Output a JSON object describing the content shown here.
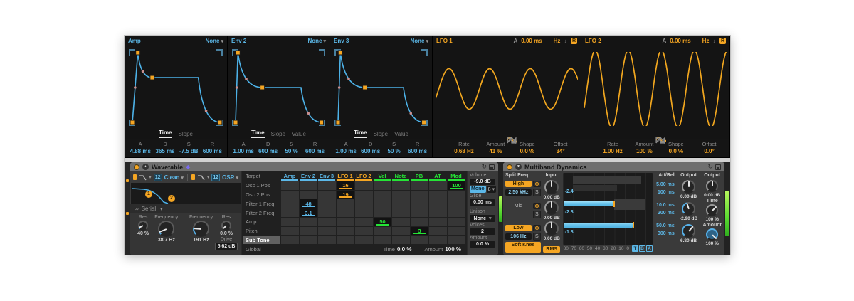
{
  "icons": {
    "caret": "▾",
    "sync_note": "♪",
    "link": "∞",
    "hotswap_device": "↻"
  },
  "env_panels": [
    {
      "name": "Amp",
      "mod_src": "None",
      "tabs": [
        "Time",
        "Slope"
      ],
      "active_tab": "Time",
      "adsr_labels": [
        "A",
        "D",
        "S",
        "R"
      ],
      "adsr_values": [
        "4.88 ms",
        "365 ms",
        "-7.5 dB",
        "600 ms"
      ],
      "curve": {
        "px": 0.13,
        "sx": 0.27,
        "sl": 0.38,
        "ex": 0.72,
        "rx": 0.93
      }
    },
    {
      "name": "Env 2",
      "mod_src": "None",
      "tabs": [
        "Time",
        "Slope",
        "Value"
      ],
      "active_tab": "Time",
      "adsr_labels": [
        "A",
        "D",
        "S",
        "R"
      ],
      "adsr_values": [
        "1.00 ms",
        "600 ms",
        "50 %",
        "600 ms"
      ],
      "curve": {
        "px": 0.1,
        "sx": 0.34,
        "sl": 0.5,
        "ex": 0.72,
        "rx": 0.92
      }
    },
    {
      "name": "Env 3",
      "mod_src": "None",
      "tabs": [
        "Time",
        "Slope",
        "Value"
      ],
      "active_tab": "Time",
      "adsr_labels": [
        "A",
        "D",
        "S",
        "R"
      ],
      "adsr_values": [
        "1.00 ms",
        "600 ms",
        "50 %",
        "600 ms"
      ],
      "curve": {
        "px": 0.1,
        "sx": 0.34,
        "sl": 0.5,
        "ex": 0.72,
        "rx": 0.92
      }
    }
  ],
  "lfo_panels": [
    {
      "name": "LFO 1",
      "attack_label": "A",
      "attack_value": "0.00 ms",
      "rate_mode": "Hz",
      "retrigger_label": "R",
      "param_labels": [
        "Rate",
        "Amount",
        "Shape",
        "Offset"
      ],
      "param_values": [
        "0.68 Hz",
        "41 %",
        "0.0 %",
        "34°"
      ],
      "wave": {
        "amp": 0.22,
        "cycles": 3.5
      }
    },
    {
      "name": "LFO 2",
      "attack_label": "A",
      "attack_value": "0.00 ms",
      "rate_mode": "Hz",
      "retrigger_label": "R",
      "param_labels": [
        "Rate",
        "Amount",
        "Shape",
        "Offset"
      ],
      "param_values": [
        "1.00 Hz",
        "100 %",
        "0.0 %",
        "0.0°"
      ],
      "wave": {
        "amp": 0.42,
        "cycles": 4.3
      }
    }
  ],
  "wavetable": {
    "title": "Wavetable",
    "filter1": {
      "slope": "12",
      "type": "Clean"
    },
    "filter2": {
      "slope": "12",
      "type": "OSR"
    },
    "filter_badges": [
      "1",
      "2"
    ],
    "routing": "Serial",
    "knobs": {
      "res1_label": "Res",
      "res1": "40 %",
      "freq1_label": "Frequency",
      "freq1": "38.7 Hz",
      "freq2_label": "Frequency",
      "freq2": "191 Hz",
      "res2_label": "Res",
      "res2": "0.0 %",
      "drive_label": "Drive",
      "drive": "5.62 dB"
    },
    "matrix": {
      "target_header": "Target",
      "columns": [
        {
          "label": "Amp",
          "color": "blue"
        },
        {
          "label": "Env 2",
          "color": "blue"
        },
        {
          "label": "Env 3",
          "color": "blue"
        },
        {
          "label": "LFO 1",
          "color": "orange"
        },
        {
          "label": "LFO 2",
          "color": "orange"
        },
        {
          "label": "Vel",
          "color": "green"
        },
        {
          "label": "Note",
          "color": "green"
        },
        {
          "label": "PB",
          "color": "green"
        },
        {
          "label": "AT",
          "color": "green"
        },
        {
          "label": "Mod",
          "color": "green"
        }
      ],
      "rows": [
        "Osc 1 Pos",
        "Osc 2 Pos",
        "Filter 1 Freq",
        "Filter 2 Freq",
        "Amp",
        "Pitch",
        "Sub Tone",
        "Global"
      ],
      "selected_row": "Sub Tone",
      "values": [
        {
          "row": 0,
          "col": 3,
          "value": "16",
          "color": "orange"
        },
        {
          "row": 0,
          "col": 9,
          "value": "100",
          "color": "green"
        },
        {
          "row": 1,
          "col": 3,
          "value": "19",
          "color": "orange"
        },
        {
          "row": 2,
          "col": 1,
          "value": "48",
          "color": "blue"
        },
        {
          "row": 3,
          "col": 1,
          "value": "3.1",
          "color": "blue"
        },
        {
          "row": 4,
          "col": 5,
          "value": "50",
          "color": "green"
        },
        {
          "row": 5,
          "col": 7,
          "value": "3",
          "color": "green"
        }
      ],
      "footer": {
        "time_label": "Time",
        "time": "0.0 %",
        "amount_label": "Amount",
        "amount": "100 %"
      }
    },
    "global": {
      "volume_label": "Volume",
      "volume": "-9.0 dB",
      "mode": "Mono",
      "mode_voices": "8",
      "glide_label": "Glide",
      "glide": "0.00 ms",
      "unison_label": "Unison",
      "unison": "None",
      "voices_label": "Voices",
      "voices": "2",
      "amount_label": "Amount",
      "amount": "0.0 %"
    }
  },
  "multiband": {
    "title": "Multiband Dynamics",
    "headers": {
      "split": "Split Freq",
      "input": "Input",
      "attrel": "Att/Rel",
      "output": "Output",
      "master": "Output"
    },
    "bands": [
      {
        "name": "High",
        "freq": "2.50 kHz",
        "solo": "S",
        "input": "0.00 dB",
        "attack": "5.00 ms",
        "release": "100 ms",
        "output": "0.00 dB",
        "level": "-2.4"
      },
      {
        "name": "Mid",
        "solo": "S",
        "input": "0.00 dB",
        "attack": "10.0 ms",
        "release": "200 ms",
        "output": "-2.90 dB",
        "level": "-2.8"
      },
      {
        "name": "Low",
        "freq": "106 Hz",
        "solo": "S",
        "input": "0.00 dB",
        "attack": "50.0 ms",
        "release": "300 ms",
        "output": "6.80 dB",
        "level": "-1.8"
      }
    ],
    "soft_knee_label": "Soft Knee",
    "rms_label": "RMS",
    "scale": [
      "80",
      "70",
      "60",
      "50",
      "40",
      "30",
      "20",
      "10",
      "0"
    ],
    "tba": [
      "T",
      "B",
      "A"
    ],
    "master": {
      "output": "0.00 dB",
      "time_label": "Time",
      "time": "100 %",
      "amount_label": "Amount",
      "amount": "100 %"
    }
  }
}
